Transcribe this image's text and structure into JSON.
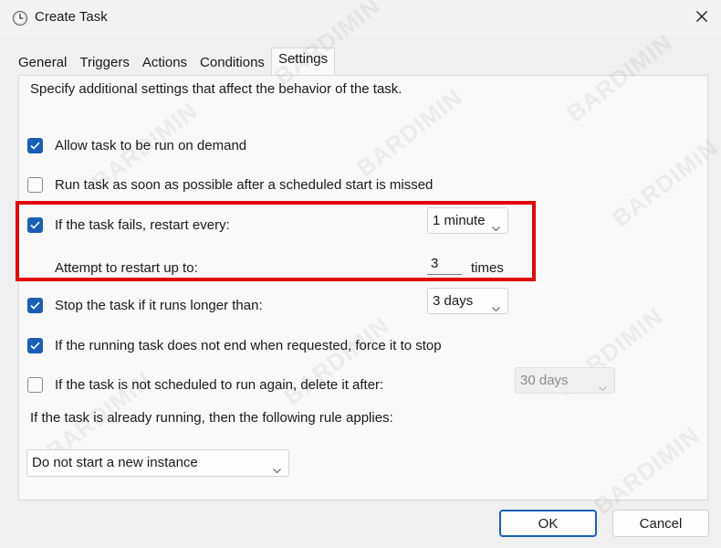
{
  "window": {
    "title": "Create Task",
    "icon": "clock-icon"
  },
  "tabs": [
    {
      "label": "General",
      "active": false
    },
    {
      "label": "Triggers",
      "active": false
    },
    {
      "label": "Actions",
      "active": false
    },
    {
      "label": "Conditions",
      "active": false
    },
    {
      "label": "Settings",
      "active": true
    }
  ],
  "settings": {
    "description": "Specify additional settings that affect the behavior of the task.",
    "allow_on_demand": {
      "label": "Allow task to be run on demand",
      "checked": true
    },
    "run_asap": {
      "label": "Run task as soon as possible after a scheduled start is missed",
      "checked": false
    },
    "restart_on_fail": {
      "label": "If the task fails, restart every:",
      "checked": true,
      "interval": "1 minute"
    },
    "restart_attempts": {
      "label": "Attempt to restart up to:",
      "value": "3",
      "unit": "times"
    },
    "stop_if_longer": {
      "label": "Stop the task if it runs longer than:",
      "checked": true,
      "duration": "3 days"
    },
    "force_stop": {
      "label": "If the running task does not end when requested, force it to stop",
      "checked": true
    },
    "delete_after": {
      "label": "If the task is not scheduled to run again, delete it after:",
      "checked": false,
      "duration": "30 days"
    },
    "rule_label": "If the task is already running, then the following rule applies:",
    "rule_value": "Do not start a new instance"
  },
  "buttons": {
    "ok": "OK",
    "cancel": "Cancel"
  },
  "colors": {
    "accent": "#1a5fb4",
    "highlight": "#e0060b"
  },
  "watermark": "BARDIMIN"
}
